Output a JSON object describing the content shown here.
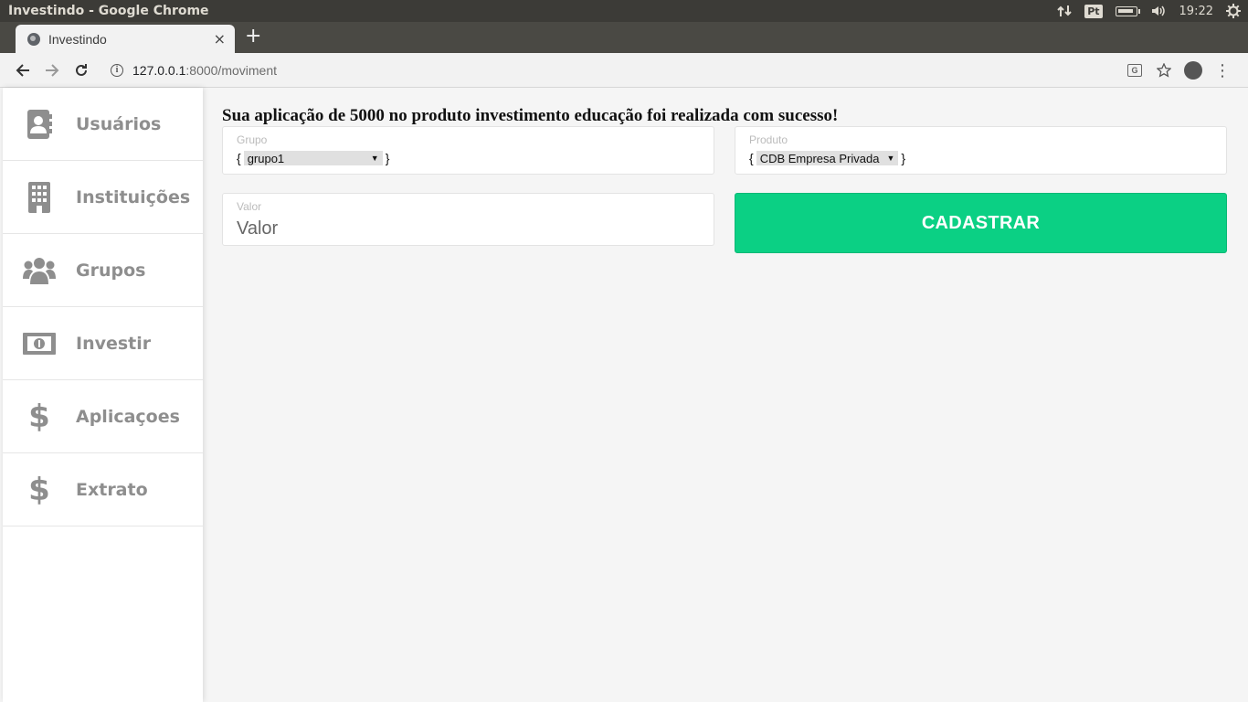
{
  "os": {
    "window_title": "Investindo - Google Chrome",
    "language_badge": "Pt",
    "time": "19:22"
  },
  "browser": {
    "tab_title": "Investindo",
    "tab_close": "×",
    "new_tab": "+",
    "url_host": "127.0.0.1",
    "url_path": ":8000/moviment"
  },
  "sidebar": {
    "items": [
      {
        "label": "Usuários",
        "icon": "address-book-icon"
      },
      {
        "label": "Instituições",
        "icon": "building-icon"
      },
      {
        "label": "Grupos",
        "icon": "users-icon"
      },
      {
        "label": "Investir",
        "icon": "money-bill-icon"
      },
      {
        "label": "Aplicaçoes",
        "icon": "dollar-icon"
      },
      {
        "label": "Extrato",
        "icon": "dollar-icon"
      }
    ],
    "dollar_glyph": "$"
  },
  "main": {
    "message": "Sua aplicação de 5000 no produto investimento educação foi realizada com sucesso!",
    "grupo": {
      "label": "Grupo",
      "brace_open": "{",
      "selected": "grupo1",
      "brace_close": "}"
    },
    "produto": {
      "label": "Produto",
      "brace_open": "{",
      "selected": "CDB Empresa Privada",
      "brace_close": "}"
    },
    "valor": {
      "label": "Valor",
      "placeholder": "Valor"
    },
    "submit_label": "CADASTRAR"
  },
  "colors": {
    "accent": "#0bd084",
    "sidebar_text": "#8e8e8e",
    "os_bar": "#3c3b37"
  }
}
